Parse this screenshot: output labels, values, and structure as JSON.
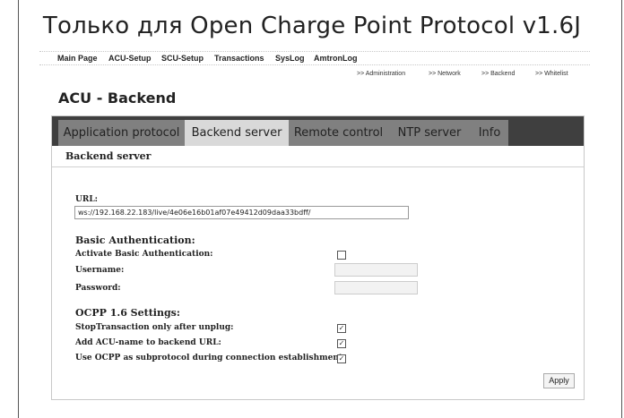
{
  "banner": "Только для Open Charge Point Protocol v1.6J",
  "top_menu": [
    "Main Page",
    "ACU-Setup",
    "SCU-Setup",
    "Transactions",
    "SysLog",
    "AmtronLog"
  ],
  "sub_menu": [
    ">> Administration",
    ">> Network",
    ">> Backend",
    ">> Whitelist"
  ],
  "page_title": "ACU - Backend",
  "tabs": [
    "Application protocol",
    "Backend server",
    "Remote control",
    "NTP server",
    "Info"
  ],
  "active_tab": "Backend server",
  "section": "Backend server",
  "url": {
    "label": "URL:",
    "value": "ws://192.168.22.183/live/4e06e16b01af07e49412d09daa33bdff/"
  },
  "basic_auth": {
    "heading": "Basic Authentication:",
    "activate_label": "Activate Basic Authentication:",
    "activate_checked": false,
    "username_label": "Username:",
    "username_value": "",
    "password_label": "Password:",
    "password_value": ""
  },
  "ocpp": {
    "heading": "OCPP 1.6 Settings:",
    "stop_label": "StopTransaction only after unplug:",
    "stop_checked": true,
    "add_label": "Add ACU-name to backend URL:",
    "add_checked": true,
    "sub_label": "Use OCPP as subprotocol during connection establishment:",
    "sub_checked": true
  },
  "apply_label": "Apply",
  "check_glyph": "☑",
  "colors": {
    "tabbar_bg": "#3f3f3f",
    "tab_bg": "#808080",
    "tab_active_bg": "#d9d9d9"
  }
}
